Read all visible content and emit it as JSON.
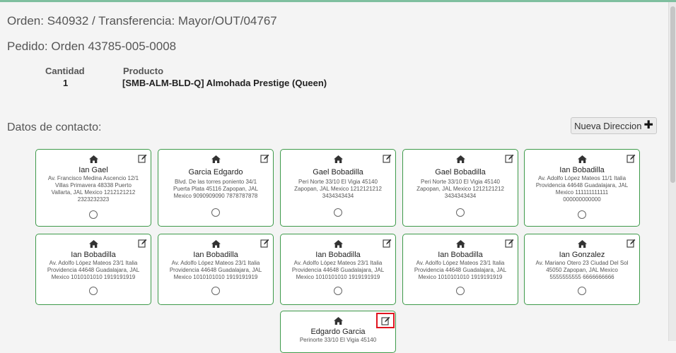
{
  "header": {
    "orden": "Orden: S40932 / Transferencia: Mayor/OUT/04767",
    "pedido": "Pedido: Orden 43785-005-0008"
  },
  "product": {
    "cantidad_label": "Cantidad",
    "producto_label": "Producto",
    "cantidad": "1",
    "producto": "[SMB-ALM-BLD-Q] Almohada Prestige (Queen)"
  },
  "contact": {
    "title": "Datos de contacto:",
    "new_button": "Nueva Direccion"
  },
  "cards": [
    {
      "name": "Ian Gael",
      "l1": "Av. Francisco Medina Ascencio 12/1",
      "l2": "Villas Primavera 48338 Puerto",
      "l3": "Vallarta, JAL Mexico 1212121212",
      "l4": "2323232323"
    },
    {
      "name": "Garcia Edgardo",
      "l1": "Blvd. De las torres poniento 34/1",
      "l2": "Puerta Plata 45116 Zapopan, JAL",
      "l3": "Mexico 9090909090 7878787878",
      "l4": ""
    },
    {
      "name": "Gael Bobadilla",
      "l1": "Peri Norte 33/10 El Vigia 45140",
      "l2": "Zapopan, JAL Mexico 1212121212",
      "l3": "3434343434",
      "l4": ""
    },
    {
      "name": "Gael Bobadilla",
      "l1": "Peri Norte 33/10 El Vigia 45140",
      "l2": "Zapopan, JAL Mexico 1212121212",
      "l3": "3434343434",
      "l4": ""
    },
    {
      "name": "Ian Bobadilla",
      "l1": "Av. Adolfo López Mateos 11/1 Italia",
      "l2": "Providencia 44648 Guadalajara, JAL",
      "l3": "Mexico 111111111111",
      "l4": "000000000000"
    },
    {
      "name": "Ian Bobadilla",
      "l1": "Av. Adolfo López Mateos 23/1 Italia",
      "l2": "Providencia 44648 Guadalajara, JAL",
      "l3": "Mexico 1010101010 1919191919",
      "l4": ""
    },
    {
      "name": "Ian Bobadilla",
      "l1": "Av. Adolfo López Mateos 23/1 Italia",
      "l2": "Providencia 44648 Guadalajara, JAL",
      "l3": "Mexico 1010101010 1919191919",
      "l4": ""
    },
    {
      "name": "Ian Bobadilla",
      "l1": "Av. Adolfo López Mateos 23/1 Italia",
      "l2": "Providencia 44648 Guadalajara, JAL",
      "l3": "Mexico 1010101010 1919191919",
      "l4": ""
    },
    {
      "name": "Ian Bobadilla",
      "l1": "Av. Adolfo López Mateos 23/1 Italia",
      "l2": "Providencia 44648 Guadalajara, JAL",
      "l3": "Mexico 1010101010 1919191919",
      "l4": ""
    },
    {
      "name": "Ian Gonzalez",
      "l1": "Av. Mariano Otero 23 Ciudad Del Sol",
      "l2": "45050 Zapopan, JAL Mexico",
      "l3": "5555555555 6666666666",
      "l4": ""
    },
    {
      "name": "Edgardo Garcia",
      "l1": "Perinorte 33/10 El Vigia 45140",
      "l2": "",
      "l3": "",
      "l4": ""
    }
  ],
  "colors": {
    "card_border": "#3e9a4a",
    "highlight": "#e0141e",
    "top_accent": "#7fbf9f"
  },
  "icons": {
    "home": "home-icon",
    "edit": "edit-icon",
    "plus": "plus-icon"
  }
}
